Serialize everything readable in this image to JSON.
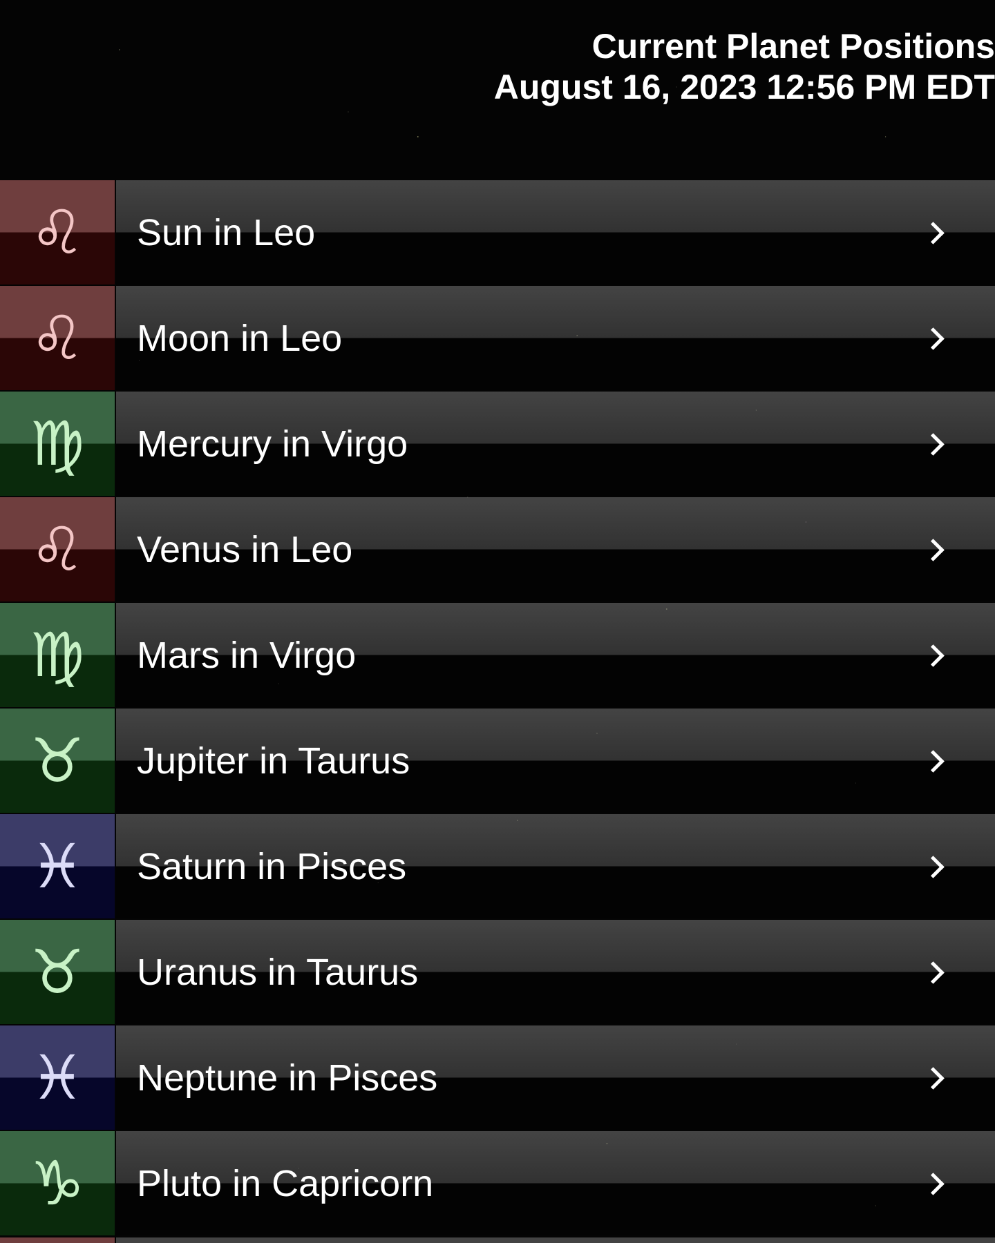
{
  "header": {
    "title": "Current Planet Positions",
    "datetime": "August 16, 2023 12:56 PM EDT"
  },
  "rows": [
    {
      "label": "Sun in Leo",
      "sign": "Leo",
      "glyph": "♌︎",
      "element": "fire"
    },
    {
      "label": "Moon in Leo",
      "sign": "Leo",
      "glyph": "♌︎",
      "element": "fire"
    },
    {
      "label": "Mercury in Virgo",
      "sign": "Virgo",
      "glyph": "♍︎",
      "element": "earth"
    },
    {
      "label": "Venus in Leo",
      "sign": "Leo",
      "glyph": "♌︎",
      "element": "fire"
    },
    {
      "label": "Mars in Virgo",
      "sign": "Virgo",
      "glyph": "♍︎",
      "element": "earth"
    },
    {
      "label": "Jupiter in Taurus",
      "sign": "Taurus",
      "glyph": "♉︎",
      "element": "earth"
    },
    {
      "label": "Saturn in Pisces",
      "sign": "Pisces",
      "glyph": "♓︎",
      "element": "water"
    },
    {
      "label": "Uranus in Taurus",
      "sign": "Taurus",
      "glyph": "♉︎",
      "element": "earth"
    },
    {
      "label": "Neptune in Pisces",
      "sign": "Pisces",
      "glyph": "♓︎",
      "element": "water"
    },
    {
      "label": "Pluto in Capricorn",
      "sign": "Capricorn",
      "glyph": "♑︎",
      "element": "earth"
    }
  ],
  "colors": {
    "fire_sign_bg": "#6f3e3e",
    "earth_sign_bg": "#3a6644",
    "water_sign_bg": "#3c3c68",
    "text": "#ffffff"
  }
}
